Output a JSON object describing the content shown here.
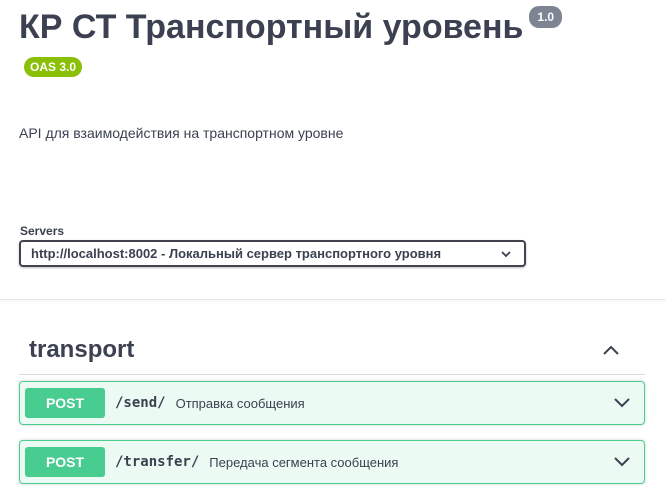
{
  "info": {
    "title": "КР СТ Транспортный уровень",
    "version": "1.0",
    "oas_badge": "OAS 3.0",
    "description": "API для взаимодействия на транспортном уровне"
  },
  "servers": {
    "label": "Servers",
    "selected": "http://localhost:8002 - Локальный сервер транспортного уровня"
  },
  "tag": {
    "name": "transport",
    "expanded": true
  },
  "operations": [
    {
      "method": "POST",
      "path": "/send/",
      "summary": "Отправка сообщения"
    },
    {
      "method": "POST",
      "path": "/transfer/",
      "summary": "Передача сегмента сообщения"
    }
  ],
  "colors": {
    "post": "#49cc90",
    "oas_badge": "#89bf04",
    "version_badge": "#7d8492",
    "text": "#3b4151"
  },
  "icons": {
    "server_select": "chevron-down-icon",
    "tag_toggle": "chevron-up-icon",
    "operation_toggle": "chevron-down-icon"
  }
}
